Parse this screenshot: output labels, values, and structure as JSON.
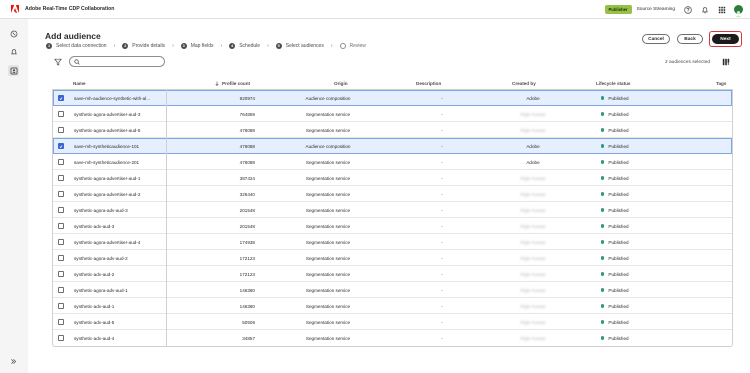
{
  "app": {
    "title": "Adobe Real-Time CDP Collaboration",
    "role_badge": "Publisher",
    "source_label": "Source Streaming",
    "brand_color": "#eb1000"
  },
  "topbar_icons": [
    "help-icon",
    "bell-icon",
    "apps-grid-icon",
    "avatar"
  ],
  "sidebar_icons": [
    "connect-icon",
    "bell-outline-icon",
    "audience-icon",
    "expand-icon"
  ],
  "page": {
    "title": "Add audience",
    "steps": [
      {
        "num": "1",
        "label": "Select data connection",
        "state": "done"
      },
      {
        "num": "2",
        "label": "Provide details",
        "state": "done"
      },
      {
        "num": "3",
        "label": "Map fields",
        "state": "done"
      },
      {
        "num": "4",
        "label": "Schedule",
        "state": "done"
      },
      {
        "num": "5",
        "label": "Select audiences",
        "state": "current"
      },
      {
        "num": "",
        "label": "Review",
        "state": "pending"
      }
    ],
    "buttons": {
      "cancel": "Cancel",
      "back": "Back",
      "next": "Next"
    },
    "search_placeholder": "",
    "selected_count": "2 audiences selected"
  },
  "table": {
    "columns": {
      "name": "Name",
      "profile_count": "Profile count",
      "origin": "Origin",
      "description": "Description",
      "created_by": "Created by",
      "lifecycle_status": "Lifecycle status",
      "tags": "Tags"
    },
    "rows": [
      {
        "selected": true,
        "name": "save-mh-audience-synthetic-with-al...",
        "profile_count": "920974",
        "origin": "Audience composition",
        "description": "-",
        "created_by": "Adobe",
        "created_by_blurred": false,
        "status": "Published"
      },
      {
        "selected": false,
        "name": "synthetic-agora-advertiser-aud-3",
        "profile_count": "764859",
        "origin": "Segmentation service",
        "description": "-",
        "created_by": "Rajiv Kumar",
        "created_by_blurred": true,
        "status": "Published"
      },
      {
        "selected": false,
        "name": "synthetic-agora-advertiser-aud-5",
        "profile_count": "476088",
        "origin": "Segmentation service",
        "description": "-",
        "created_by": "Rajiv Kumar",
        "created_by_blurred": true,
        "status": "Published"
      },
      {
        "selected": true,
        "name": "save-mh-syntheticaudience-101",
        "profile_count": "476088",
        "origin": "Audience composition",
        "description": "-",
        "created_by": "Adobe",
        "created_by_blurred": false,
        "status": "Published"
      },
      {
        "selected": false,
        "name": "save-mh-syntheticaudience-201",
        "profile_count": "476088",
        "origin": "Segmentation service",
        "description": "-",
        "created_by": "Adobe",
        "created_by_blurred": false,
        "status": "Published"
      },
      {
        "selected": false,
        "name": "synthetic-agora-advertiser-aud-1",
        "profile_count": "387424",
        "origin": "Segmentation service",
        "description": "-",
        "created_by": "Rajiv Kumar",
        "created_by_blurred": true,
        "status": "Published"
      },
      {
        "selected": false,
        "name": "synthetic-agora-advertiser-aud-2",
        "profile_count": "326440",
        "origin": "Segmentation service",
        "description": "-",
        "created_by": "Rajiv Kumar",
        "created_by_blurred": true,
        "status": "Published"
      },
      {
        "selected": false,
        "name": "synthetic-agora-adv-aud-3",
        "profile_count": "201548",
        "origin": "Segmentation service",
        "description": "-",
        "created_by": "Rajiv Kumar",
        "created_by_blurred": true,
        "status": "Published"
      },
      {
        "selected": false,
        "name": "synthetic-adv-aud-3",
        "profile_count": "201548",
        "origin": "Segmentation service",
        "description": "-",
        "created_by": "Rajiv Kumar",
        "created_by_blurred": true,
        "status": "Published"
      },
      {
        "selected": false,
        "name": "synthetic-agora-advertiser-aud-4",
        "profile_count": "174938",
        "origin": "Segmentation service",
        "description": "-",
        "created_by": "Rajiv Kumar",
        "created_by_blurred": true,
        "status": "Published"
      },
      {
        "selected": false,
        "name": "synthetic-agora-adv-aud-2",
        "profile_count": "172123",
        "origin": "Segmentation service",
        "description": "-",
        "created_by": "Rajiv Kumar",
        "created_by_blurred": true,
        "status": "Published"
      },
      {
        "selected": false,
        "name": "synthetic-adv-aud-2",
        "profile_count": "172123",
        "origin": "Segmentation service",
        "description": "-",
        "created_by": "Rajiv Kumar",
        "created_by_blurred": true,
        "status": "Published"
      },
      {
        "selected": false,
        "name": "synthetic-agora-adv-aud-1",
        "profile_count": "146380",
        "origin": "Segmentation service",
        "description": "-",
        "created_by": "Rajiv Kumar",
        "created_by_blurred": true,
        "status": "Published"
      },
      {
        "selected": false,
        "name": "synthetic-adv-aud-1",
        "profile_count": "146380",
        "origin": "Segmentation service",
        "description": "-",
        "created_by": "Rajiv Kumar",
        "created_by_blurred": true,
        "status": "Published"
      },
      {
        "selected": false,
        "name": "synthetic-adv-aud-5",
        "profile_count": "50506",
        "origin": "Segmentation service",
        "description": "-",
        "created_by": "Rajiv Kumar",
        "created_by_blurred": true,
        "status": "Published"
      },
      {
        "selected": false,
        "name": "synthetic-adv-aud-4",
        "profile_count": "34857",
        "origin": "Segmentation service",
        "description": "-",
        "created_by": "Rajiv Kumar",
        "created_by_blurred": true,
        "status": "Published"
      }
    ]
  }
}
